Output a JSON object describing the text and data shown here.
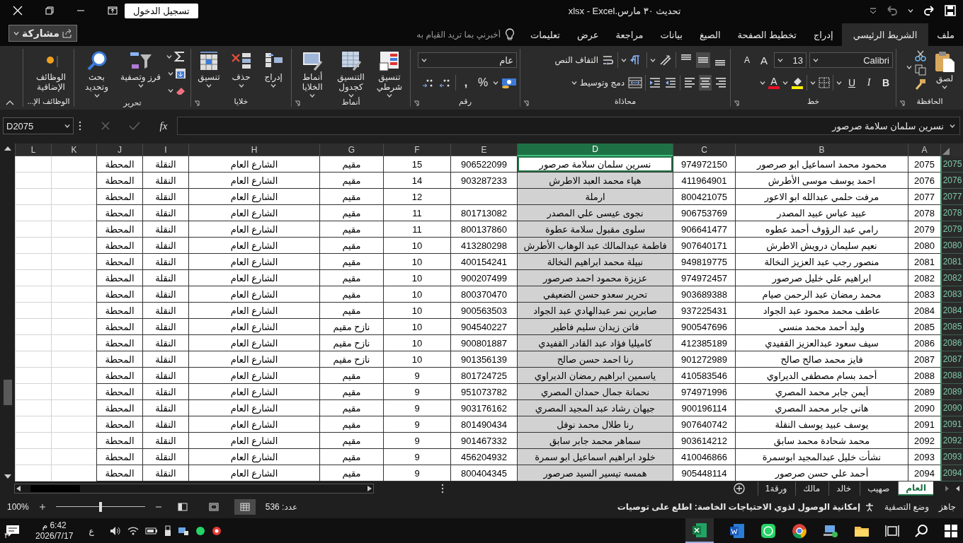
{
  "title_bar": {
    "title": "تحديث ٣٠ مارس.xlsx - Excel",
    "sign_in": "تسجيل الدخول"
  },
  "tabs": [
    {
      "label": "ملف",
      "selected": false
    },
    {
      "label": "الشريط الرئيسي",
      "selected": true
    },
    {
      "label": "إدراج",
      "selected": false
    },
    {
      "label": "تخطيط الصفحة",
      "selected": false
    },
    {
      "label": "الصيغ",
      "selected": false
    },
    {
      "label": "بيانات",
      "selected": false
    },
    {
      "label": "مراجعة",
      "selected": false
    },
    {
      "label": "عرض",
      "selected": false
    },
    {
      "label": "تعليمات",
      "selected": false
    }
  ],
  "tell_me": {
    "placeholder": "أخبرني بما تريد القيام به"
  },
  "share": "مشاركة",
  "ribbon": {
    "clipboard": {
      "label": "الحافظة",
      "paste": "لصق"
    },
    "font": {
      "label": "خط",
      "family": "Calibri",
      "size": "13",
      "grow": "A",
      "shrink": "A",
      "bold": "B",
      "italic": "I",
      "underline": "U",
      "font_color": "A"
    },
    "alignment": {
      "label": "محاذاة",
      "wrap": "التفاف النص",
      "merge": "دمج وتوسيط",
      "valign": [
        {
          "selected": false
        },
        {
          "selected": true
        },
        {
          "selected": false
        }
      ],
      "halign": [
        {
          "selected": false
        },
        {
          "selected": true
        },
        {
          "selected": false
        }
      ]
    },
    "number": {
      "label": "رقم",
      "format": "عام",
      "percent": "%",
      "comma": ","
    },
    "styles": {
      "label": "أنماط",
      "buttons": [
        "تنسيق شرطي",
        "التنسيق كجدول",
        "أنماط الخلايا"
      ]
    },
    "cells": {
      "label": "خلايا",
      "buttons": [
        "إدراج",
        "حذف",
        "تنسيق"
      ]
    },
    "editing": {
      "label": "تحرير",
      "buttons": [
        "فرز وتصفية",
        "بحث وتحديد"
      ]
    },
    "addins": {
      "label": "الوظائف الإ...",
      "button": "الوظائف الإضافية"
    }
  },
  "formula_bar": {
    "name_box": "D2075",
    "fx": "fx",
    "value": "نسرين سلمان سلامة صرصور"
  },
  "columns": [
    {
      "label": "A",
      "selected": false
    },
    {
      "label": "B",
      "selected": false
    },
    {
      "label": "C",
      "selected": false
    },
    {
      "label": "D",
      "selected": true
    },
    {
      "label": "E",
      "selected": false
    },
    {
      "label": "F",
      "selected": false
    },
    {
      "label": "G",
      "selected": false
    },
    {
      "label": "H",
      "selected": false
    },
    {
      "label": "I",
      "selected": false
    },
    {
      "label": "J",
      "selected": false
    },
    {
      "label": "K",
      "selected": false
    },
    {
      "label": "L",
      "selected": false
    }
  ],
  "rows": [
    {
      "header": "2075",
      "active": true,
      "cells": [
        "2075",
        "محمود محمد اسماعيل ابو صرصور",
        "974972150",
        "نسرين سلمان سلامة صرصور",
        "906522099",
        "15",
        "مقيم",
        "الشارع العام",
        "النقلة",
        "المحطة"
      ]
    },
    {
      "header": "2076",
      "active": false,
      "cells": [
        "2076",
        "احمد يوسف موسى الأطرش",
        "411964901",
        "هياء محمد العبد الاطرش",
        "903287233",
        "14",
        "مقيم",
        "الشارع العام",
        "النقلة",
        "المحطة"
      ]
    },
    {
      "header": "2077",
      "active": false,
      "cells": [
        "2077",
        "مرفت حلمي عبدالله ابو الاعور",
        "800421075",
        "ارملة",
        null,
        "12",
        "مقيم",
        "الشارع العام",
        "النقلة",
        "المحطة"
      ]
    },
    {
      "header": "2078",
      "active": false,
      "cells": [
        "2078",
        "عبيد عباس عبيد المصدر",
        "906753769",
        "نجوى عيسى علي المصدر",
        "801713082",
        "11",
        "مقيم",
        "الشارع العام",
        "النقلة",
        "المحطة"
      ]
    },
    {
      "header": "2079",
      "active": false,
      "cells": [
        "2079",
        "رامي عبد الرؤوف أحمد عطوه",
        "906641477",
        "سلوى مقبول سلامة عطوة",
        "800137860",
        "11",
        "مقيم",
        "الشارع العام",
        "النقلة",
        "المحطة"
      ]
    },
    {
      "header": "2080",
      "active": false,
      "cells": [
        "2080",
        "نعيم سليمان درويش الاطرش",
        "907640171",
        "فاطمة عبدالمالك عبد الوهاب الأطرش",
        "413280298",
        "10",
        "مقيم",
        "الشارع العام",
        "النقلة",
        "المحطة"
      ]
    },
    {
      "header": "2081",
      "active": false,
      "cells": [
        "2081",
        "منصور رجب عبد العزيز النخالة",
        "949819775",
        "نبيلة محمد ابراهيم النخالة",
        "400154241",
        "10",
        "مقيم",
        "الشارع العام",
        "النقلة",
        "المحطة"
      ]
    },
    {
      "header": "2082",
      "active": false,
      "cells": [
        "2082",
        "ابراهيم علي خليل صرصور",
        "974972457",
        "عزيزة محمود احمد صرصور",
        "900207499",
        "10",
        "مقيم",
        "الشارع العام",
        "النقلة",
        "المحطة"
      ]
    },
    {
      "header": "2083",
      "active": false,
      "cells": [
        "2083",
        "محمد رمضان عبد الرحمن صيام",
        "903689388",
        "تحرير سعدو حسن الضعيفي",
        "800370470",
        "10",
        "مقيم",
        "الشارع العام",
        "النقلة",
        "المحطة"
      ]
    },
    {
      "header": "2084",
      "active": false,
      "cells": [
        "2084",
        "عاطف محمد محمود عبد الجواد",
        "937225431",
        "صابرين نمر عبدالهادي عبد الجواد",
        "900563503",
        "10",
        "مقيم",
        "الشارع العام",
        "النقلة",
        "المحطة"
      ]
    },
    {
      "header": "2085",
      "active": false,
      "cells": [
        "2085",
        "وليد أحمد محمد منسي",
        "900547696",
        "فاتن زيدان سليم فاطير",
        "904540227",
        "10",
        "نازح مقيم",
        "الشارع العام",
        "النقلة",
        "المحطة"
      ]
    },
    {
      "header": "2086",
      "active": false,
      "cells": [
        "2086",
        "سيف سعود عبدالعزيز القفيدي",
        "412385189",
        "كاميليا فؤاد عبد القادر القفيدي",
        "900801887",
        "10",
        "نازح مقيم",
        "الشارع العام",
        "النقلة",
        "المحطة"
      ]
    },
    {
      "header": "2087",
      "active": false,
      "cells": [
        "2087",
        "فايز محمد صالح صالح",
        "901272989",
        "رنا احمد حسن صالح",
        "901356139",
        "10",
        "نازح مقيم",
        "الشارع العام",
        "النقلة",
        "المحطة"
      ]
    },
    {
      "header": "2088",
      "active": false,
      "cells": [
        "2088",
        "أحمد بسام مصطفى الديراوي",
        "410583546",
        "ياسمين ابراهيم رمضان الديراوي",
        "801724725",
        "9",
        "مقيم",
        "الشارع العام",
        "النقلة",
        "المحطة"
      ]
    },
    {
      "header": "2089",
      "active": false,
      "cells": [
        "2089",
        "أيمن جابر محمد المصري",
        "974971996",
        "نحمانة جمال حمدان المصري",
        "951073782",
        "9",
        "مقيم",
        "الشارع العام",
        "النقلة",
        "المحطة"
      ]
    },
    {
      "header": "2090",
      "active": false,
      "cells": [
        "2090",
        "هاني جابر محمد المصري",
        "900196114",
        "جيهان رشاد عبد المجيد المصري",
        "903176162",
        "9",
        "مقيم",
        "الشارع العام",
        "النقلة",
        "المحطة"
      ]
    },
    {
      "header": "2091",
      "active": false,
      "cells": [
        "2091",
        "يوسف عبيد يوسف النقلة",
        "907640742",
        "رنا طلال محمد نوفل",
        "801490434",
        "9",
        "مقيم",
        "الشارع العام",
        "النقلة",
        "المحطة"
      ]
    },
    {
      "header": "2092",
      "active": false,
      "cells": [
        "2092",
        "محمد شحادة محمد سابق",
        "903614212",
        "سماهر محمد جابر سابق",
        "901467332",
        "9",
        "مقيم",
        "الشارع العام",
        "النقلة",
        "المحطة"
      ]
    },
    {
      "header": "2093",
      "active": false,
      "cells": [
        "2093",
        "نشأت خليل عبدالمجيد ابوسمرة",
        "410046866",
        "خلود ابراهيم اسماعيل ابو سمرة",
        "456204932",
        "9",
        "مقيم",
        "الشارع العام",
        "النقلة",
        "المحطة"
      ]
    },
    {
      "header": "2094",
      "active": false,
      "cells": [
        "2094",
        "أحمد علي حسن صرصور",
        "905448114",
        "همسه تيسير السيد صرصور",
        "800404345",
        "9",
        "مقيم",
        "الشارع العام",
        "النقلة",
        "المحطة"
      ]
    }
  ],
  "sheets": [
    {
      "label": "العام",
      "selected": true
    },
    {
      "label": "صهيب",
      "selected": false
    },
    {
      "label": "خالد",
      "selected": false
    },
    {
      "label": "مالك",
      "selected": false
    },
    {
      "label": "ورقة1",
      "selected": false
    }
  ],
  "status_bar": {
    "ready": "جاهز",
    "filter_mode": "وضع التصفية",
    "accessibility": "إمكانية الوصول لذوي الاحتياجات الخاصة: اطلع على توصيات",
    "count": "عدد: 536",
    "views": [
      {
        "selected": true
      },
      {
        "selected": false
      },
      {
        "selected": false
      }
    ],
    "zoom": {
      "level": 0.5
    },
    "zoom_label": "100%"
  },
  "taskbar": {
    "language": "ع",
    "time": "6:42 م",
    "date": "2026/7/17",
    "notifications": "٣"
  }
}
